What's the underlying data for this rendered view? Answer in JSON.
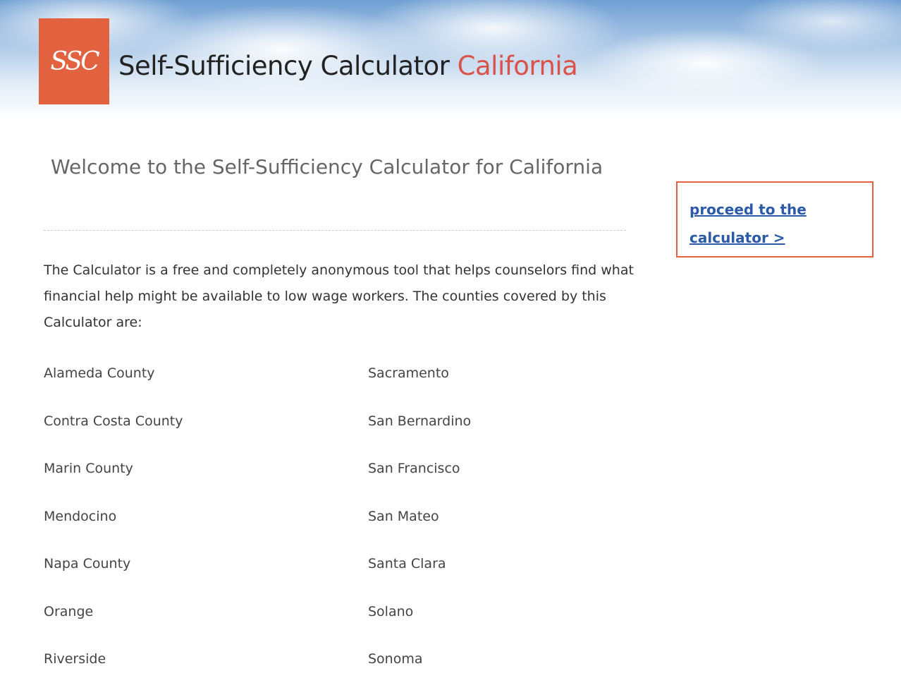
{
  "header": {
    "logo_text": "SSC",
    "title_main": "Self-Sufficiency Calculator",
    "title_accent": "California"
  },
  "main": {
    "heading": "Welcome to the Self-Sufficiency Calculator for California",
    "intro": "The Calculator is a free and completely anonymous tool that helps counselors find what financial help might be available to low wage workers. The counties covered by this Calculator are:",
    "counties": [
      "Alameda County",
      "Sacramento",
      "Contra Costa County",
      "San Bernardino",
      "Marin County",
      "San Francisco",
      "Mendocino",
      "San Mateo",
      "Napa County",
      "Santa Clara",
      "Orange",
      "Solano",
      "Riverside",
      "Sonoma"
    ]
  },
  "sidebar": {
    "proceed_link": "proceed to the calculator >"
  },
  "colors": {
    "brand": "#e2613f",
    "accent_text": "#d9534a",
    "link": "#2b5aa8"
  }
}
